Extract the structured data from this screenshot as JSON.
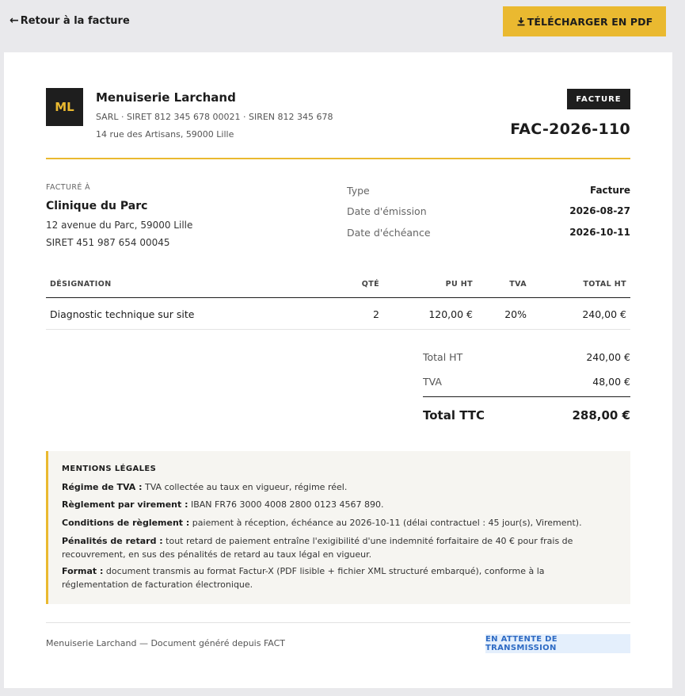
{
  "toolbar": {
    "back_label": "Retour à la facture",
    "download_label": "TÉLÉCHARGER EN PDF",
    "accent": "#eab930"
  },
  "company": {
    "initials": "ML",
    "name": "Menuiserie Larchand",
    "legal": "SARL · SIRET 812 345 678 00021 · SIREN 812 345 678",
    "address": "14 rue des Artisans, 59000 Lille"
  },
  "document": {
    "badge": "FACTURE",
    "number": "FAC-2026-110"
  },
  "client": {
    "label": "FACTURÉ À",
    "name": "Clinique du Parc",
    "address": "12 avenue du Parc, 59000 Lille",
    "siret": "SIRET 451 987 654 00045"
  },
  "meta": [
    {
      "label": "Type",
      "value": "Facture"
    },
    {
      "label": "Date d'émission",
      "value": "2026-08-27"
    },
    {
      "label": "Date d'échéance",
      "value": "2026-10-11"
    }
  ],
  "table": {
    "headers": {
      "designation": "DÉSIGNATION",
      "qty": "QTÉ",
      "unit_price": "PU HT",
      "vat": "TVA",
      "total": "TOTAL HT"
    },
    "rows": [
      {
        "designation": "Diagnostic technique sur site",
        "qty": "2",
        "unit_price": "120,00 €",
        "vat": "20%",
        "total": "240,00 €"
      }
    ]
  },
  "totals": {
    "ht_label": "Total HT",
    "ht_value": "240,00 €",
    "vat_label": "TVA",
    "vat_value": "48,00 €",
    "ttc_label": "Total TTC",
    "ttc_value": "288,00 €"
  },
  "mentions": {
    "title": "MENTIONS LÉGALES",
    "items": [
      {
        "label": "Régime de TVA :",
        "text": " TVA collectée au taux en vigueur, régime réel."
      },
      {
        "label": "Règlement par virement :",
        "text": " IBAN FR76 3000 4008 2800 0123 4567 890."
      },
      {
        "label": "Conditions de règlement :",
        "text": " paiement à réception, échéance au 2026-10-11 (délai contractuel : 45 jour(s), Virement)."
      },
      {
        "label": "Pénalités de retard :",
        "text": " tout retard de paiement entraîne l'exigibilité d'une indemnité forfaitaire de 40 € pour frais de recouvrement, en sus des pénalités de retard au taux légal en vigueur."
      },
      {
        "label": "Format :",
        "text": " document transmis au format Factur-X (PDF lisible + fichier XML structuré embarqué), conforme à la réglementation de facturation électronique."
      }
    ]
  },
  "footer": {
    "text": "Menuiserie Larchand — Document généré depuis FACT",
    "status": "EN ATTENTE DE TRANSMISSION"
  }
}
